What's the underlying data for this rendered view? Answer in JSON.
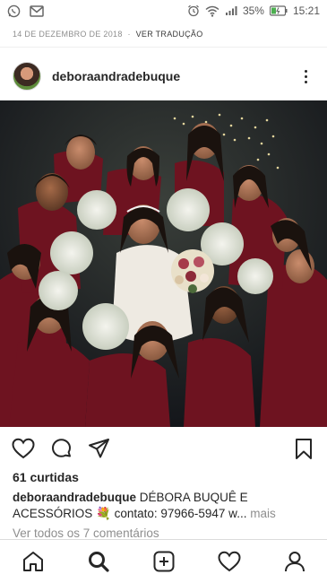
{
  "status_bar": {
    "battery": "35%",
    "time": "15:21",
    "left_icons": [
      "whatsapp-icon",
      "gmail-icon"
    ],
    "right_icons": [
      "alarm-icon",
      "wifi-icon",
      "signal-icon",
      "battery-icon"
    ]
  },
  "post": {
    "date": "14 DE DEZEMBRO DE 2018",
    "separator": "·",
    "translate_label": "VER TRADUÇÃO",
    "username": "deboraandradebuque",
    "likes": "61 curtidas",
    "caption_user": "deboraandradebuque",
    "caption_text": "DÉBORA BUQUÊ E ACESSÓRIOS 💐 contato: 97966-5947 w...",
    "caption_more": "mais",
    "comments_link": "Ver todos os 7 comentários"
  },
  "actions": [
    "heart-icon",
    "comment-icon",
    "share-icon",
    "bookmark-icon"
  ],
  "bottom_nav": [
    "home-icon",
    "search-icon",
    "new-post-icon",
    "activity-heart-icon",
    "profile-icon"
  ],
  "colors": {
    "text": "#262626",
    "muted": "#8e8e8e",
    "border": "#dbdbdb",
    "dress": "#7a1420",
    "statusbar_icons": "#555555"
  }
}
